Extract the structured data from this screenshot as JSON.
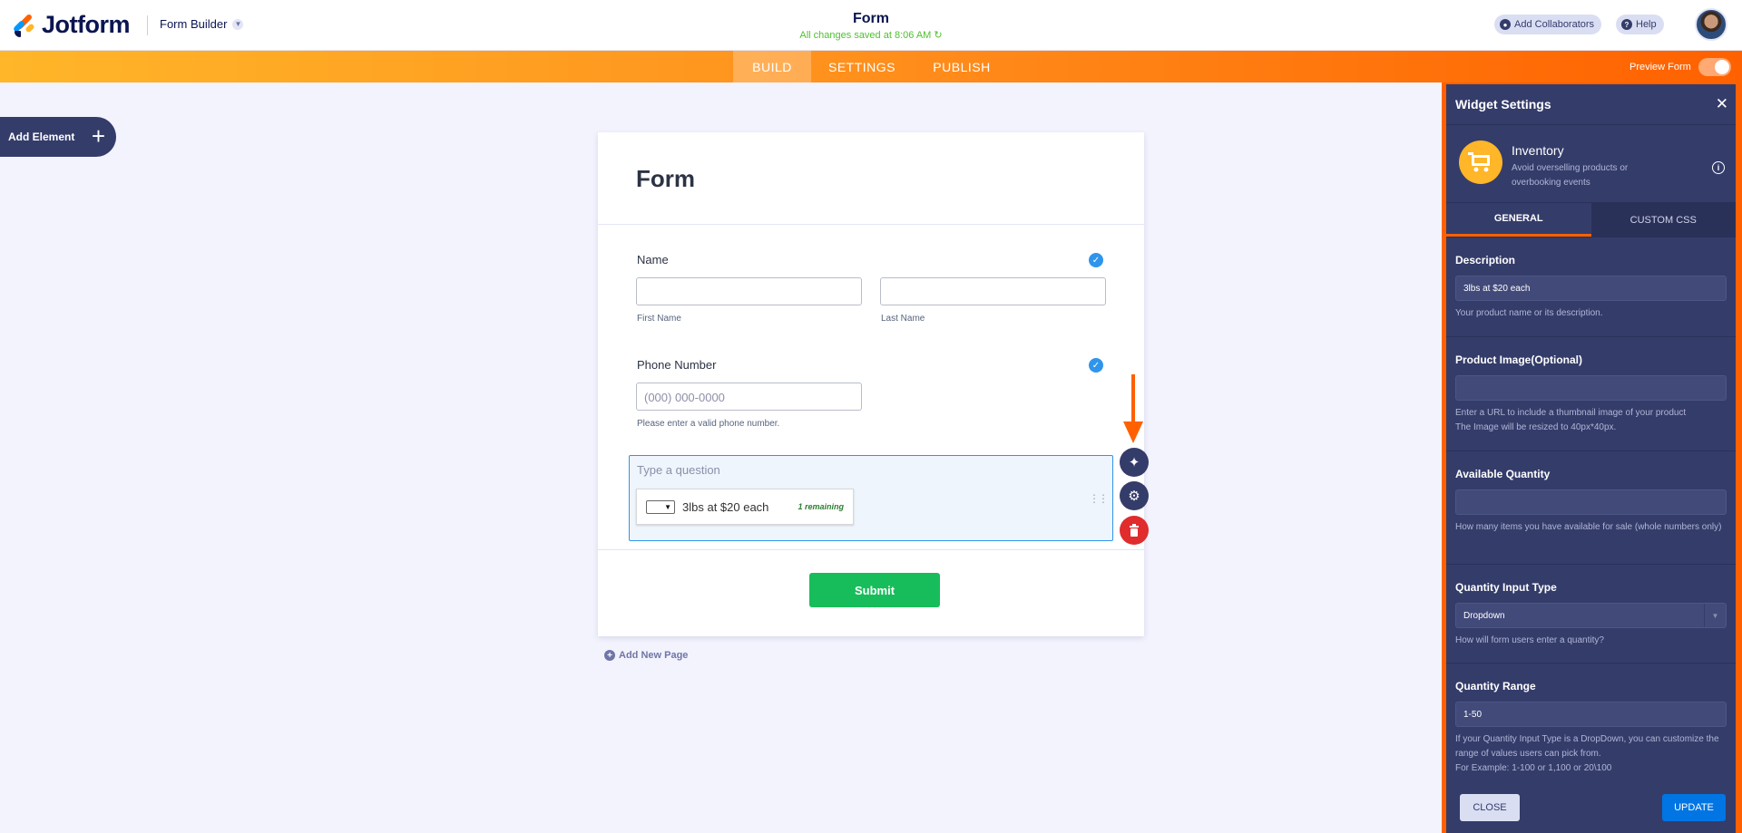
{
  "header": {
    "logo_text": "Jotform",
    "builder_label": "Form Builder",
    "title": "Form",
    "saved_status": "All changes saved at 8:06 AM",
    "add_collaborators": "Add Collaborators",
    "help": "Help"
  },
  "nav": {
    "tabs": [
      {
        "label": "BUILD",
        "active": true
      },
      {
        "label": "SETTINGS",
        "active": false
      },
      {
        "label": "PUBLISH",
        "active": false
      }
    ],
    "preview_label": "Preview Form"
  },
  "sidebar": {
    "add_element": "Add Element"
  },
  "form": {
    "title": "Form",
    "name_label": "Name",
    "first_name_sublabel": "First Name",
    "last_name_sublabel": "Last Name",
    "phone_label": "Phone Number",
    "phone_placeholder": "(000) 000-0000",
    "phone_sublabel": "Please enter a valid phone number.",
    "widget_question_placeholder": "Type a question",
    "inventory_item_desc": "3lbs at $20 each",
    "inventory_remaining": "1 remaining",
    "submit_label": "Submit",
    "add_new_page": "Add New Page"
  },
  "panel": {
    "title": "Widget Settings",
    "widget_name": "Inventory",
    "widget_desc": "Avoid overselling products or overbooking events",
    "tabs": [
      {
        "label": "GENERAL",
        "active": true
      },
      {
        "label": "CUSTOM CSS",
        "active": false
      }
    ],
    "fields": {
      "description": {
        "label": "Description",
        "value": "3lbs at $20 each",
        "help": "Your product name or its description."
      },
      "product_image": {
        "label": "Product Image(Optional)",
        "value": "",
        "help_1": "Enter a URL to include a thumbnail image of your product",
        "help_2": "The Image will be resized to 40px*40px."
      },
      "available_quantity": {
        "label": "Available Quantity",
        "value": "",
        "help": "How many items you have available for sale (whole numbers only)"
      },
      "quantity_input_type": {
        "label": "Quantity Input Type",
        "value": "Dropdown",
        "help": "How will form users enter a quantity?"
      },
      "quantity_range": {
        "label": "Quantity Range",
        "value": "1-50",
        "help_1": "If your Quantity Input Type is a DropDown, you can customize the range of values users can pick from.",
        "help_2": "For Example: 1-100 or 1,100 or 20\\100"
      }
    },
    "close_label": "CLOSE",
    "update_label": "UPDATE"
  },
  "colors": {
    "brand_orange": "#ff6100",
    "panel_bg": "#343c6a",
    "submit_green": "#18bd5b",
    "update_blue": "#0075e3",
    "delete_red": "#e02c2c"
  }
}
